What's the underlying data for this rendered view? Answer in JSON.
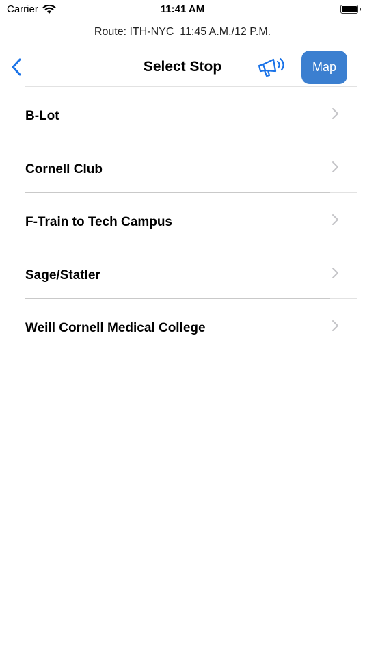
{
  "status_bar": {
    "carrier": "Carrier",
    "time": "11:41 AM"
  },
  "route": {
    "text": "Route: ITH-NYC  11:45 A.M./12 P.M."
  },
  "nav": {
    "title": "Select Stop",
    "map_label": "Map",
    "back_icon": "chevron-left-icon",
    "announce_icon": "megaphone-icon"
  },
  "colors": {
    "accent": "#3b7fd0",
    "tint": "#1a73e8"
  },
  "stops": [
    {
      "label": "B-Lot"
    },
    {
      "label": "Cornell Club"
    },
    {
      "label": "F-Train to Tech Campus"
    },
    {
      "label": "Sage/Statler"
    },
    {
      "label": "Weill Cornell Medical College"
    }
  ]
}
